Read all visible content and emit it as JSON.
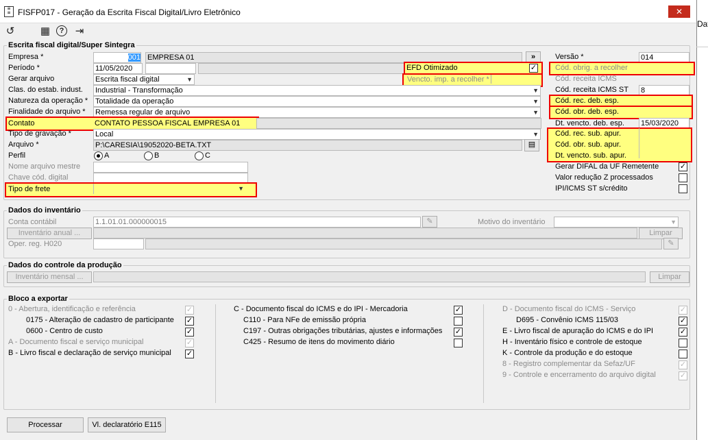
{
  "window": {
    "title": "FISFP017 - Geração da Escrita Fiscal Digital/Livro Eletrônico",
    "close": "✕",
    "bg_text": "Data"
  },
  "toolbar": {
    "undo": "↺",
    "calendar": "▦",
    "help": "?",
    "exit": "⇥"
  },
  "escrita": {
    "group_title": "Escrita fiscal digital/Super Sintegra",
    "empresa_label": "Empresa *",
    "empresa_code": "001",
    "empresa_name": "EMPRESA 01",
    "more": "»",
    "periodo_label": "Período *",
    "periodo_value": "11/05/2020",
    "efd_otimizado": "EFD Otimizado",
    "vencto_label": "Vencto. imp. a recolher *",
    "gerar_label": "Gerar arquivo",
    "gerar_value": "Escrita fiscal digital",
    "clas_label": "Clas. do estab. indust.",
    "clas_value": "Industrial - Transformação",
    "natureza_label": "Natureza da operação *",
    "natureza_value": "Totalidade da operação",
    "finalidade_label": "Finalidade do arquivo *",
    "finalidade_value": "Remessa regular de arquivo",
    "contato_label": "Contato",
    "contato_value": "CONTATO PESSOA FISCAL EMPRESA 01",
    "gravacao_label": "Tipo de gravação *",
    "gravacao_value": "Local",
    "arquivo_label": "Arquivo *",
    "arquivo_value": "P:\\CARESIA\\19052020-BETA.TXT",
    "perfil_label": "Perfil",
    "perfil_options": [
      "A",
      "B",
      "C"
    ],
    "nome_mestre_label": "Nome arquivo mestre",
    "chave_label": "Chave cód. digital",
    "frete_label": "Tipo de frete",
    "versao_label": "Versão *",
    "versao_value": "014",
    "cod_obrig_label": "Cód. obrig. a recolher",
    "cod_rec_icms_label": "Cód. receita ICMS",
    "cod_rec_icms_st_label": "Cód. receita ICMS ST",
    "cod_rec_icms_st_value": "8",
    "cod_rec_deb_label": "Cód. rec. deb. esp.",
    "cod_obr_deb_label": "Cód. obr. deb. esp.",
    "dt_vencto_deb_label": "Dt. vencto. deb. esp.",
    "dt_vencto_deb_value": "15/03/2020",
    "cod_rec_sub_label": "Cód. rec. sub. apur.",
    "cod_obr_sub_label": "Cód. obr. sub. apur.",
    "dt_vencto_sub_label": "Dt. vencto. sub. apur.",
    "difal_label": "Gerar DIFAL da UF Remetente",
    "reducao_label": "Valor redução Z processados",
    "ipi_label": "IPI/ICMS ST s/crédito"
  },
  "inventario": {
    "group_title": "Dados do inventário",
    "conta_label": "Conta contábil",
    "conta_value": "1.1.01.01.000000015",
    "motivo_label": "Motivo do inventário",
    "anual_button": "Inventário anual ...",
    "limpar": "Limpar",
    "oper_label": "Oper. reg. H020"
  },
  "producao": {
    "group_title": "Dados do controle da produção",
    "mensal_button": "Inventário mensal ...",
    "limpar": "Limpar"
  },
  "bloco": {
    "group_title": "Bloco a exportar",
    "col1": [
      {
        "label": "0 - Abertura, identificação e referência",
        "checked": true,
        "disabled": true
      },
      {
        "label": "0175 - Alteração de cadastro de participante",
        "checked": true,
        "disabled": false
      },
      {
        "label": "0600 - Centro de custo",
        "checked": true,
        "disabled": false
      },
      {
        "label": "A - Documento fiscal e serviço municipal",
        "checked": true,
        "disabled": true
      },
      {
        "label": "B - Livro fiscal e declaração de serviço municipal",
        "checked": true,
        "disabled": false
      }
    ],
    "col2": [
      {
        "label": "C - Documento fiscal do ICMS e do IPI - Mercadoria",
        "checked": true,
        "disabled": false
      },
      {
        "label": "C110 - Para NFe de emissão própria",
        "checked": false,
        "disabled": false
      },
      {
        "label": "C197 - Outras obrigações tributárias, ajustes e informações",
        "checked": true,
        "disabled": false
      },
      {
        "label": "C425 - Resumo de itens do movimento diário",
        "checked": false,
        "disabled": false
      }
    ],
    "col3": [
      {
        "label": "D - Documento fiscal do ICMS - Serviço",
        "checked": true,
        "disabled": true
      },
      {
        "label": "D695 - Convênio ICMS 115/03",
        "checked": true,
        "disabled": false
      },
      {
        "label": "E - Livro fiscal de apuração do ICMS e do IPI",
        "checked": true,
        "disabled": false
      },
      {
        "label": "H - Inventário físico e controle de estoque",
        "checked": false,
        "disabled": false
      },
      {
        "label": "K - Controle da produção e do estoque",
        "checked": false,
        "disabled": false
      },
      {
        "label": "8 - Registro complementar da Sefaz/UF",
        "checked": true,
        "disabled": true
      },
      {
        "label": "9 - Controle e encerramento do arquivo digital",
        "checked": true,
        "disabled": true
      }
    ]
  },
  "footer": {
    "processar": "Processar",
    "vl_declaratorio": "Vl. declaratório E115"
  },
  "colors": {
    "highlight": "#ffff80",
    "red_border": "#e00000",
    "selection": "#3399ff",
    "close_red": "#c42b1c"
  }
}
